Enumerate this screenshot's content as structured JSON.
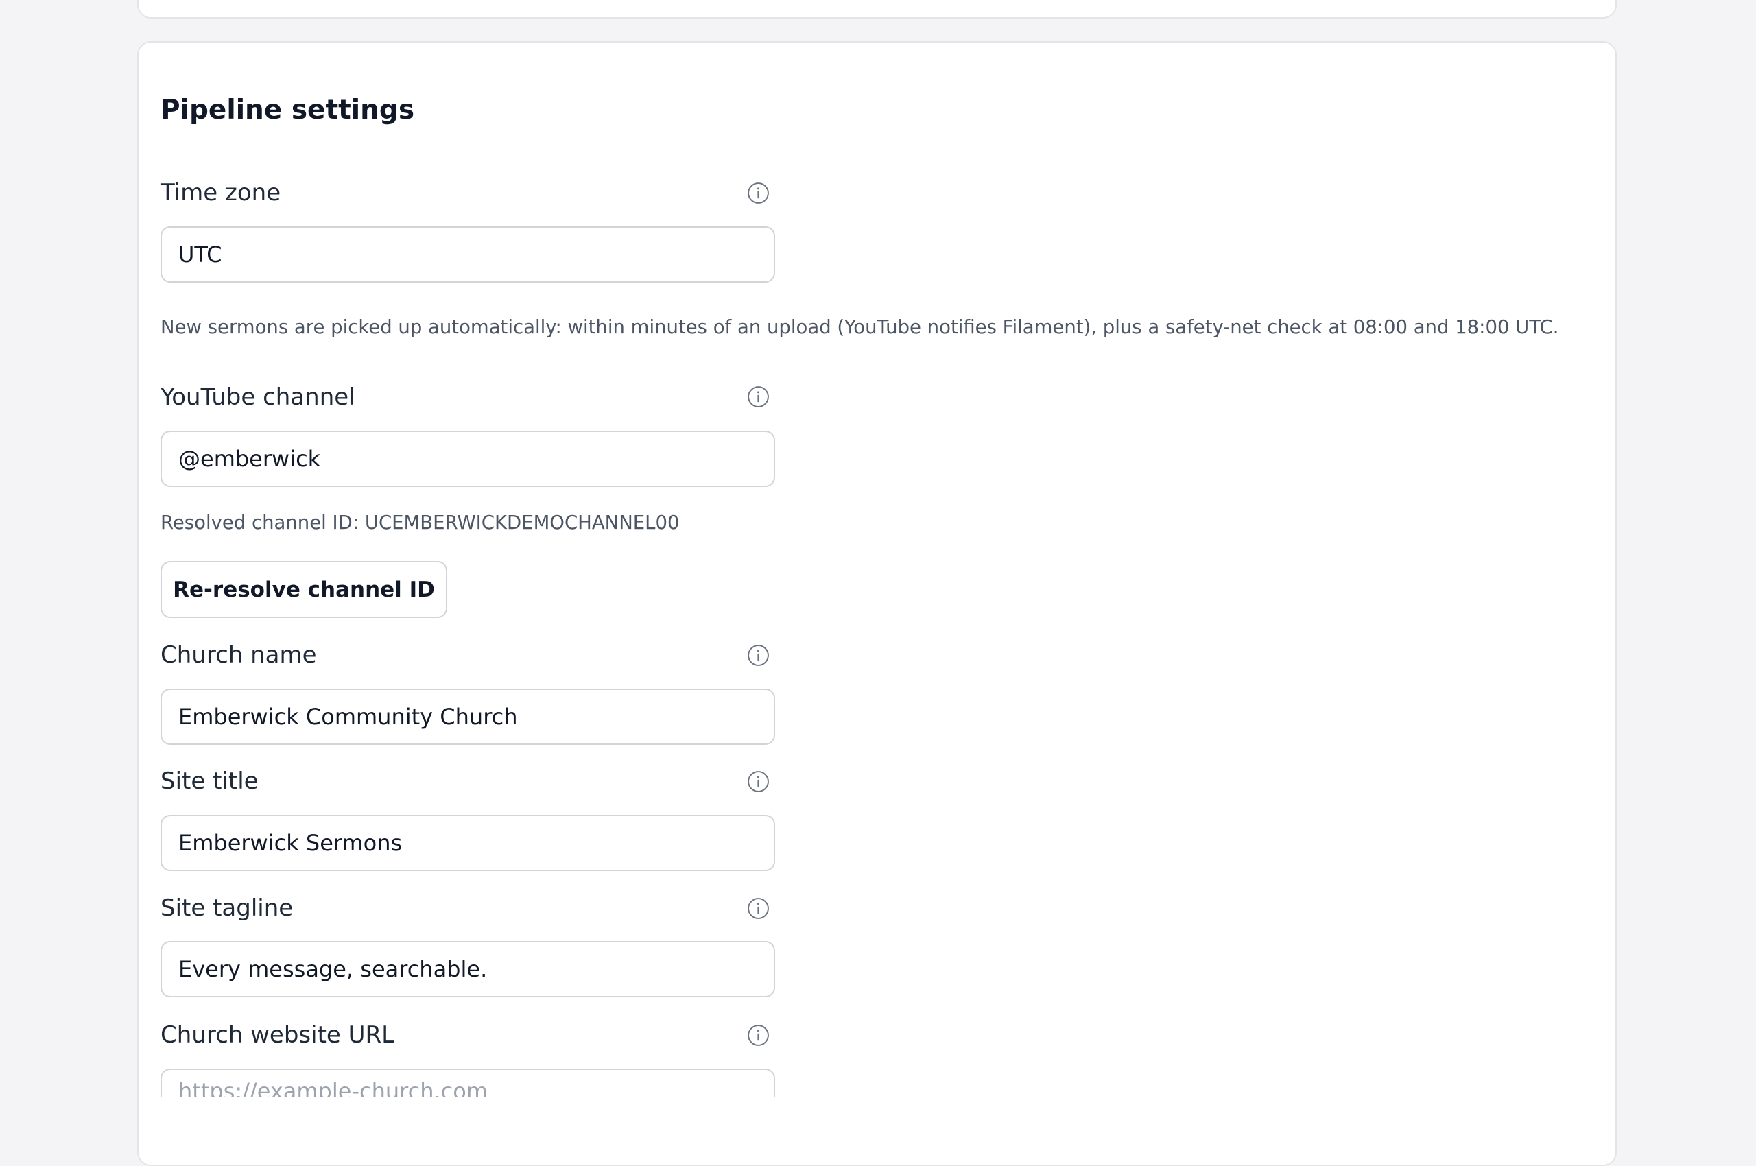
{
  "section": {
    "title": "Pipeline settings"
  },
  "fields": {
    "time_zone": {
      "label": "Time zone",
      "value": "UTC",
      "helper": "New sermons are picked up automatically: within minutes of an upload (YouTube notifies Filament), plus a safety-net check at 08:00 and 18:00 UTC."
    },
    "youtube_channel": {
      "label": "YouTube channel",
      "value": "@emberwick",
      "helper": "Resolved channel ID: UCEMBERWICKDEMOCHANNEL00",
      "button_label": "Re-resolve channel ID"
    },
    "church_name": {
      "label": "Church name",
      "value": "Emberwick Community Church"
    },
    "site_title": {
      "label": "Site title",
      "value": "Emberwick Sermons"
    },
    "site_tagline": {
      "label": "Site tagline",
      "value": "Every message, searchable."
    },
    "church_website_url": {
      "label": "Church website URL",
      "value": "",
      "placeholder": "https://example-church.com"
    }
  },
  "icons": {
    "info": "info-circle-icon"
  },
  "colors": {
    "background": "#f4f4f6",
    "card": "#ffffff",
    "border": "#d4d4d8",
    "text": "#111827",
    "muted": "#4b5563",
    "icon": "#6b7280"
  }
}
